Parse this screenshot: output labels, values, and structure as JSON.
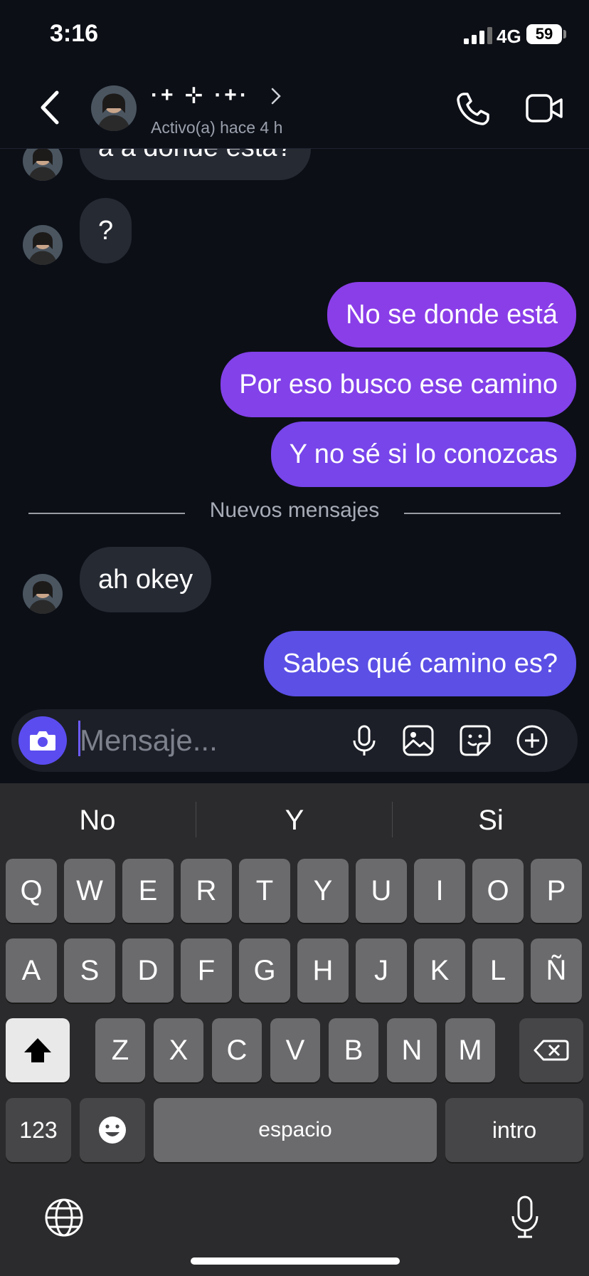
{
  "status_bar": {
    "time": "3:16",
    "network": "4G",
    "battery": "59"
  },
  "header": {
    "contact_name": "·+ ⊹ ·+·",
    "contact_status": "Activo(a) hace 4 h"
  },
  "messages": [
    {
      "direction": "in",
      "text": "a a donde está?"
    },
    {
      "direction": "in",
      "text": "?"
    },
    {
      "direction": "out",
      "text": "No se donde está"
    },
    {
      "direction": "out",
      "text": "Por eso busco ese camino"
    },
    {
      "direction": "out",
      "text": "Y no sé si lo conozcas"
    },
    {
      "direction": "in",
      "text": "ah okey"
    },
    {
      "direction": "out",
      "text": "Sabes qué camino es?"
    }
  ],
  "divider": "Nuevos mensajes",
  "composer": {
    "placeholder": "Mensaje..."
  },
  "keyboard": {
    "suggestions": [
      "No",
      "Y",
      "Si"
    ],
    "row1": [
      "Q",
      "W",
      "E",
      "R",
      "T",
      "Y",
      "U",
      "I",
      "O",
      "P"
    ],
    "row2": [
      "A",
      "S",
      "D",
      "F",
      "G",
      "H",
      "J",
      "K",
      "L",
      "Ñ"
    ],
    "row3": [
      "Z",
      "X",
      "C",
      "V",
      "B",
      "N",
      "M"
    ],
    "numbers_key": "123",
    "space_key": "espacio",
    "return_key": "intro"
  },
  "colors": {
    "bubble_out_top": "#8a3ee8",
    "bubble_out_bottom": "#5b4fe6",
    "bubble_in": "#262a33",
    "accent": "#5b4cf0"
  }
}
